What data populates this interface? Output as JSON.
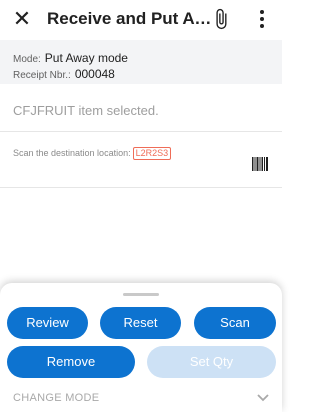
{
  "header": {
    "title": "Receive and Put Away",
    "close_icon": "close-icon",
    "attach_icon": "paperclip-icon",
    "more_icon": "more-vertical-icon"
  },
  "info": {
    "mode_label": "Mode:",
    "mode_value": "Put Away mode",
    "receipt_label": "Receipt Nbr.:",
    "receipt_value": "000048"
  },
  "status": {
    "message": "CFJFRUIT item selected."
  },
  "scan": {
    "prompt": "Scan the destination location:",
    "location": "L2R2S3",
    "icon": "barcode-icon"
  },
  "actions": {
    "review": "Review",
    "reset": "Reset",
    "scan": "Scan",
    "remove": "Remove",
    "set_qty": "Set Qty"
  },
  "mode_bar": {
    "label": "CHANGE MODE",
    "icon": "chevron-down-icon"
  },
  "colors": {
    "primary": "#0d73d0",
    "primary_disabled": "#cde1f5",
    "location_highlight": "#ef6c57",
    "info_background": "#f3f4f6"
  }
}
